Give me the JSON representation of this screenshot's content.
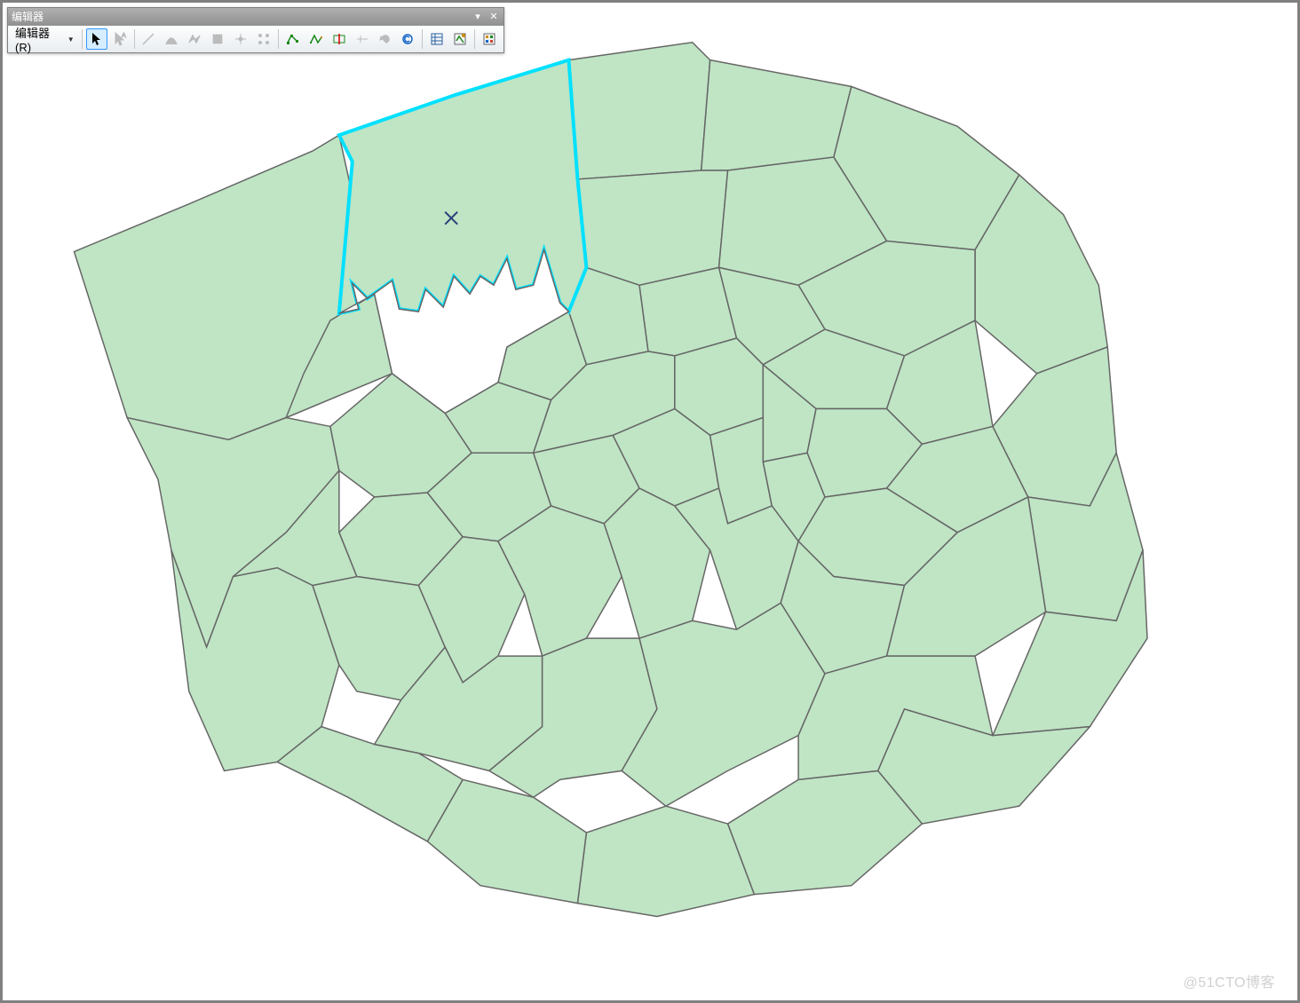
{
  "toolbar": {
    "title": "编辑器",
    "menu_label": "编辑器(R)",
    "icons": [
      {
        "name": "edit-tool-icon",
        "selected": true,
        "enabled": true
      },
      {
        "name": "edit-annotation-icon",
        "selected": false,
        "enabled": false
      },
      {
        "name": "straight-segment-icon",
        "selected": false,
        "enabled": false
      },
      {
        "name": "end-point-arc-icon",
        "selected": false,
        "enabled": false
      },
      {
        "name": "trace-icon",
        "selected": false,
        "enabled": false
      },
      {
        "name": "right-angle-icon",
        "selected": false,
        "enabled": false
      },
      {
        "name": "midpoint-icon",
        "selected": false,
        "enabled": false
      },
      {
        "name": "point-icon",
        "selected": false,
        "enabled": false
      },
      {
        "name": "edit-vertices-icon",
        "selected": false,
        "enabled": true
      },
      {
        "name": "reshape-icon",
        "selected": false,
        "enabled": true
      },
      {
        "name": "cut-polygons-icon",
        "selected": false,
        "enabled": true
      },
      {
        "name": "split-icon",
        "selected": false,
        "enabled": false
      },
      {
        "name": "rotate-icon",
        "selected": false,
        "enabled": false
      },
      {
        "name": "attributes-icon",
        "selected": false,
        "enabled": true
      },
      {
        "name": "sketch-properties-icon",
        "selected": false,
        "enabled": true
      },
      {
        "name": "create-features-icon",
        "selected": false,
        "enabled": true
      },
      {
        "name": "table-of-contents-icon",
        "selected": false,
        "enabled": true
      }
    ]
  },
  "map": {
    "fill_color": "#bfe5c4",
    "stroke_color": "#666666",
    "selection_color": "#00e0ff",
    "selected_feature_marker": "×"
  },
  "watermark": "@51CTO博客"
}
